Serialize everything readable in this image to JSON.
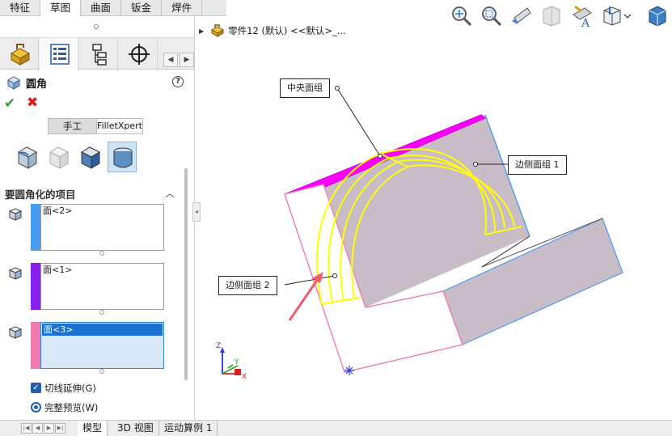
{
  "command_tabs": [
    "特征",
    "草图",
    "曲面",
    "钣金",
    "焊件"
  ],
  "property_manager": {
    "title": "圆角",
    "help": "?",
    "ok": "✔",
    "cancel": "✖",
    "mode_manual": "手工",
    "mode_xpert": "FilletXpert",
    "section_title": "要圆角化的项目",
    "selections": [
      {
        "label": "面<2>",
        "color": "#4a9cf0"
      },
      {
        "label": "面<1>",
        "color": "#8a1ef0"
      },
      {
        "label": "面<3>",
        "color": "#f07ab0"
      }
    ],
    "options": {
      "tangent": "切线延伸(G)",
      "preview": "完整预览(W)"
    }
  },
  "breadcrumb": "零件12 (默认) <<默认>_...",
  "callouts": {
    "center": "中央面组",
    "side1": "边侧面组 1",
    "side2": "边侧面组 2"
  },
  "triad": {
    "x": "X",
    "y": "Y",
    "z": "Z"
  },
  "bottom_tabs": [
    "模型",
    "3D 视图",
    "运动算例 1"
  ],
  "colors": {
    "highlight": "#ff00ff",
    "preview": "#ffff00",
    "edge_side1": "#4a9cf0",
    "edge_side2": "#f07ab0",
    "face": "#c8bcc6",
    "annotation_arrow": "#f05a6a"
  }
}
